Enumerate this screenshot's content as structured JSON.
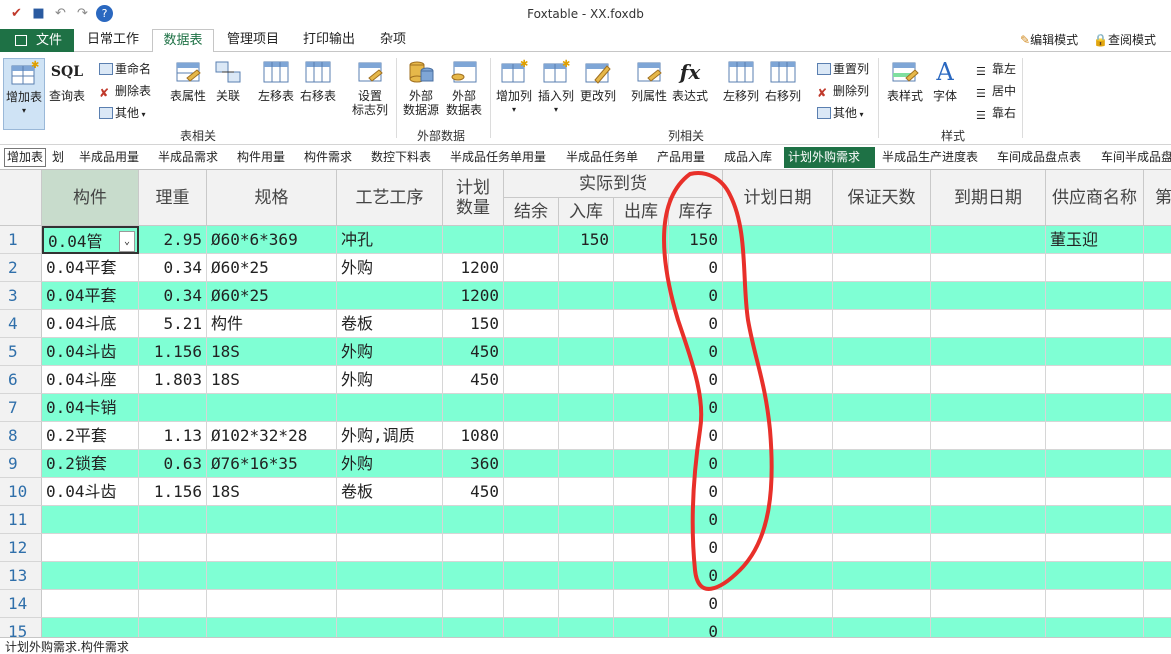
{
  "window": {
    "title": "Foxtable - XX.foxdb"
  },
  "menu": {
    "file": "文件",
    "tabs": [
      "日常工作",
      "数据表",
      "管理项目",
      "打印输出",
      "杂项"
    ],
    "edit_mode": "编辑模式",
    "view_mode": "查阅模式"
  },
  "ribbon": {
    "add_table": "增加表",
    "sql": "SQL",
    "query_table": "查询表",
    "rename": "重命名",
    "delete_table": "删除表",
    "other": "其他",
    "table_props": "表属性",
    "relation": "关联",
    "move_left": "左移表",
    "move_right": "右移表",
    "set_flag_col": [
      "设置",
      "标志列"
    ],
    "ext_source": [
      "外部",
      "数据源"
    ],
    "ext_table": [
      "外部",
      "数据表"
    ],
    "add_col": "增加列",
    "insert_col": "插入列",
    "change_col": "更改列",
    "col_props": "列属性",
    "expression": "表达式",
    "col_left": "左移列",
    "col_right": "右移列",
    "reset_col": "重置列",
    "delete_col": "删除列",
    "other2": "其他",
    "table_style": "表样式",
    "font": "字体",
    "align_left": "靠左",
    "align_center": "居中",
    "align_right": "靠右",
    "group_table": "表相关",
    "group_external": "外部数据",
    "group_column": "列相关",
    "group_style": "样式",
    "fx_icon": "fx"
  },
  "sheets": {
    "add_button": "增加表",
    "tabs": [
      "划",
      "半成品用量",
      "半成品需求",
      "构件用量",
      "构件需求",
      "数控下料表",
      "半成品任务单用量",
      "半成品任务单",
      "产品用量",
      "成品入库",
      "计划外购需求",
      "半成品生产进度表",
      "车间成品盘点表",
      "车间半成品盘"
    ],
    "active": "计划外购需求"
  },
  "grid": {
    "headers": {
      "component": "构件",
      "weight": "理重",
      "spec": "规格",
      "process": "工艺工序",
      "plan_qty": "计划数量",
      "actual": "实际到货",
      "balance": "结余",
      "inbound": "入库",
      "outbound": "出库",
      "stock": "库存",
      "plan_date": "计划日期",
      "warranty_days": "保证天数",
      "expire_date": "到期日期",
      "supplier": "供应商名称",
      "next": "第"
    },
    "rows": [
      {
        "n": "1",
        "c": "0.04管",
        "w": "2.95",
        "s": "Ø60*6*369",
        "p": "冲孔",
        "q": "",
        "in": "150",
        "st": "150",
        "sup": "董玉迎"
      },
      {
        "n": "2",
        "c": "0.04平套",
        "w": "0.34",
        "s": "Ø60*25",
        "p": "外购",
        "q": "1200",
        "in": "",
        "st": "0",
        "sup": ""
      },
      {
        "n": "3",
        "c": "0.04平套",
        "w": "0.34",
        "s": "Ø60*25",
        "p": "",
        "q": "1200",
        "in": "",
        "st": "0",
        "sup": ""
      },
      {
        "n": "4",
        "c": "0.04斗底",
        "w": "5.21",
        "s": "构件",
        "p": "卷板",
        "q": "150",
        "in": "",
        "st": "0",
        "sup": ""
      },
      {
        "n": "5",
        "c": "0.04斗齿",
        "w": "1.156",
        "s": "18S",
        "p": "外购",
        "q": "450",
        "in": "",
        "st": "0",
        "sup": ""
      },
      {
        "n": "6",
        "c": "0.04斗座",
        "w": "1.803",
        "s": "18S",
        "p": "外购",
        "q": "450",
        "in": "",
        "st": "0",
        "sup": ""
      },
      {
        "n": "7",
        "c": "0.04卡销",
        "w": "",
        "s": "",
        "p": "",
        "q": "",
        "in": "",
        "st": "0",
        "sup": ""
      },
      {
        "n": "8",
        "c": "0.2平套",
        "w": "1.13",
        "s": "Ø102*32*28",
        "p": "外购,调质",
        "q": "1080",
        "in": "",
        "st": "0",
        "sup": ""
      },
      {
        "n": "9",
        "c": "0.2锁套",
        "w": "0.63",
        "s": "Ø76*16*35",
        "p": "外购",
        "q": "360",
        "in": "",
        "st": "0",
        "sup": ""
      },
      {
        "n": "10",
        "c": "0.04斗齿",
        "w": "1.156",
        "s": "18S",
        "p": "卷板",
        "q": "450",
        "in": "",
        "st": "0",
        "sup": ""
      },
      {
        "n": "11",
        "c": "",
        "w": "",
        "s": "",
        "p": "",
        "q": "",
        "in": "",
        "st": "0",
        "sup": ""
      },
      {
        "n": "12",
        "c": "",
        "w": "",
        "s": "",
        "p": "",
        "q": "",
        "in": "",
        "st": "0",
        "sup": ""
      },
      {
        "n": "13",
        "c": "",
        "w": "",
        "s": "",
        "p": "",
        "q": "",
        "in": "",
        "st": "0",
        "sup": ""
      },
      {
        "n": "14",
        "c": "",
        "w": "",
        "s": "",
        "p": "",
        "q": "",
        "in": "",
        "st": "0",
        "sup": ""
      },
      {
        "n": "15",
        "c": "",
        "w": "",
        "s": "",
        "p": "",
        "q": "",
        "in": "",
        "st": "0",
        "sup": ""
      }
    ]
  },
  "status": {
    "text": "计划外购需求.构件需求"
  },
  "colors": {
    "row_alt": "#7fffd4",
    "accent": "#1e7145",
    "annotation": "#e8302a"
  }
}
